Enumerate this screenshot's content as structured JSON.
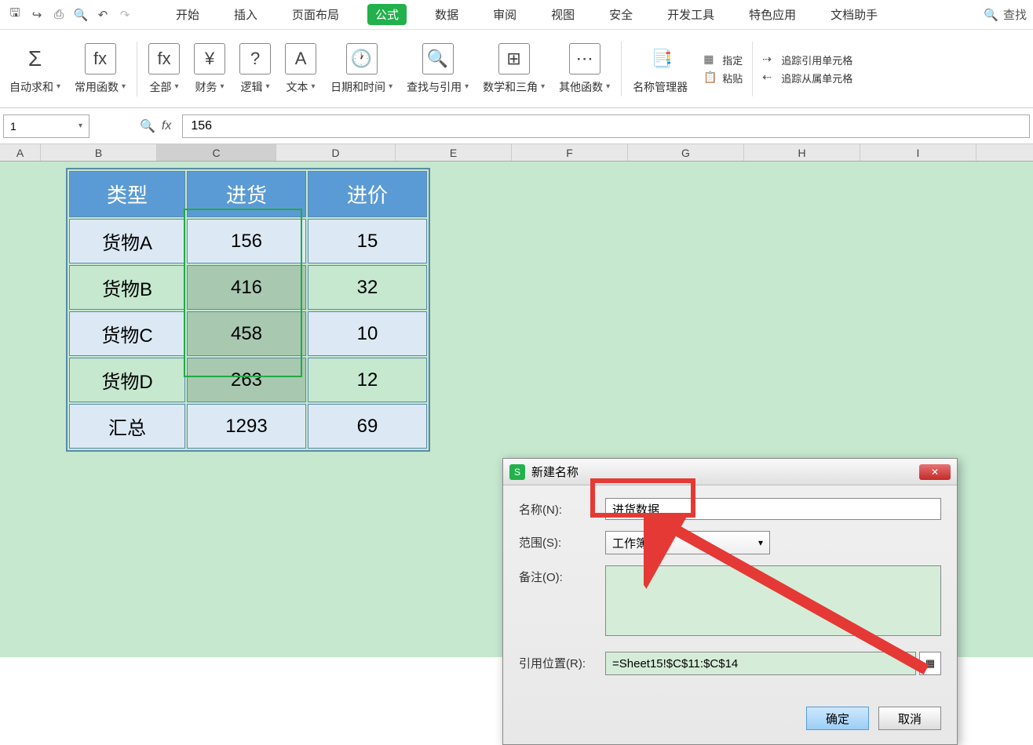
{
  "quickbar": {
    "search": "查找"
  },
  "tabs": {
    "items": [
      "开始",
      "插入",
      "页面布局",
      "公式",
      "数据",
      "审阅",
      "视图",
      "安全",
      "开发工具",
      "特色应用",
      "文档助手"
    ],
    "active_index": 3
  },
  "ribbon": {
    "autosum": "自动求和",
    "common": "常用函数",
    "all": "全部",
    "finance": "财务",
    "logic": "逻辑",
    "text": "文本",
    "datetime": "日期和时间",
    "lookup": "查找与引用",
    "math": "数学和三角",
    "other": "其他函数",
    "name_mgr": "名称管理器",
    "paste": "粘贴",
    "define": "指定",
    "trace_prec": "追踪引用单元格",
    "trace_dep": "追踪从属单元格"
  },
  "formula_bar": {
    "namebox": "1",
    "formula": "156"
  },
  "columns": [
    "A",
    "B",
    "C",
    "D",
    "E",
    "F",
    "G",
    "H",
    "I"
  ],
  "table": {
    "headers": [
      "类型",
      "进货",
      "进价"
    ],
    "rows": [
      {
        "type": "货物A",
        "stock": "156",
        "price": "15"
      },
      {
        "type": "货物B",
        "stock": "416",
        "price": "32"
      },
      {
        "type": "货物C",
        "stock": "458",
        "price": "10"
      },
      {
        "type": "货物D",
        "stock": "263",
        "price": "12"
      }
    ],
    "summary": {
      "type": "汇总",
      "stock": "1293",
      "price": "69"
    }
  },
  "dialog": {
    "title": "新建名称",
    "name_label": "名称(N):",
    "name_value": "进货数据",
    "scope_label": "范围(S):",
    "scope_value": "工作簿",
    "comment_label": "备注(O):",
    "ref_label": "引用位置(R):",
    "ref_value": "=Sheet15!$C$11:$C$14",
    "ok": "确定",
    "cancel": "取消"
  }
}
